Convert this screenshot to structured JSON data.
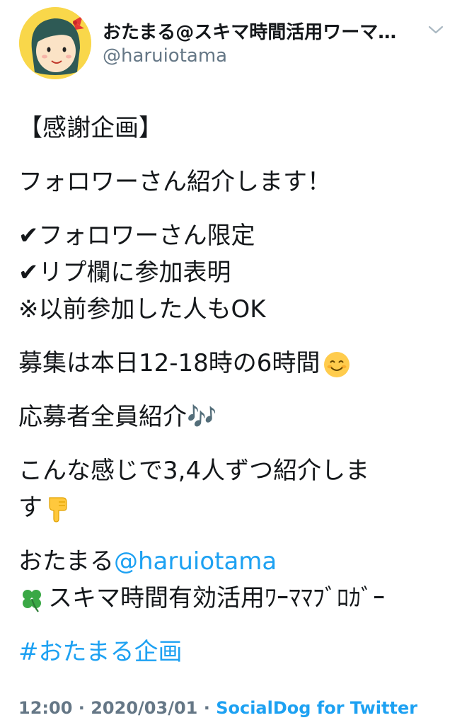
{
  "header": {
    "display_name": "おたまる@スキマ時間活用ワーマ…",
    "handle": "@haruiotama",
    "menu_icon": "chevron-down-icon",
    "avatar_icon": "avatar-illustration"
  },
  "tweet": {
    "line1": "【感謝企画】",
    "line2": "フォロワーさん紹介します！",
    "check_mark": "✔",
    "line3": "フォロワーさん限定",
    "line4": "リプ欄に参加表明",
    "line5": "※以前参加した人もOK",
    "line6": "募集は本日12-18時の6時間",
    "line6_emoji": "smiling-face-emoji",
    "line7": "応募者全員紹介",
    "line7_emoji": "🎶",
    "line8": "こんな感じで3,4人ずつ紹介しま",
    "line8b": "す",
    "line8_emoji": "pointing-down-emoji",
    "line9_prefix": "おたまる",
    "line9_mention": "@haruiotama",
    "line10_icon": "four-leaf-clover-icon",
    "line10": "スキマ時間有効活用ﾜｰﾏﾏﾌﾞﾛｶﾞｰ",
    "hashtag": "#おたまる企画"
  },
  "footer": {
    "time": "12:00",
    "separator": " · ",
    "date": "2020/03/01",
    "separator2": " · ",
    "source": "SocialDog for Twitter"
  },
  "colors": {
    "link": "#1da1f2",
    "secondary_text": "#657786",
    "avatar_bg": "#f9d74a"
  }
}
